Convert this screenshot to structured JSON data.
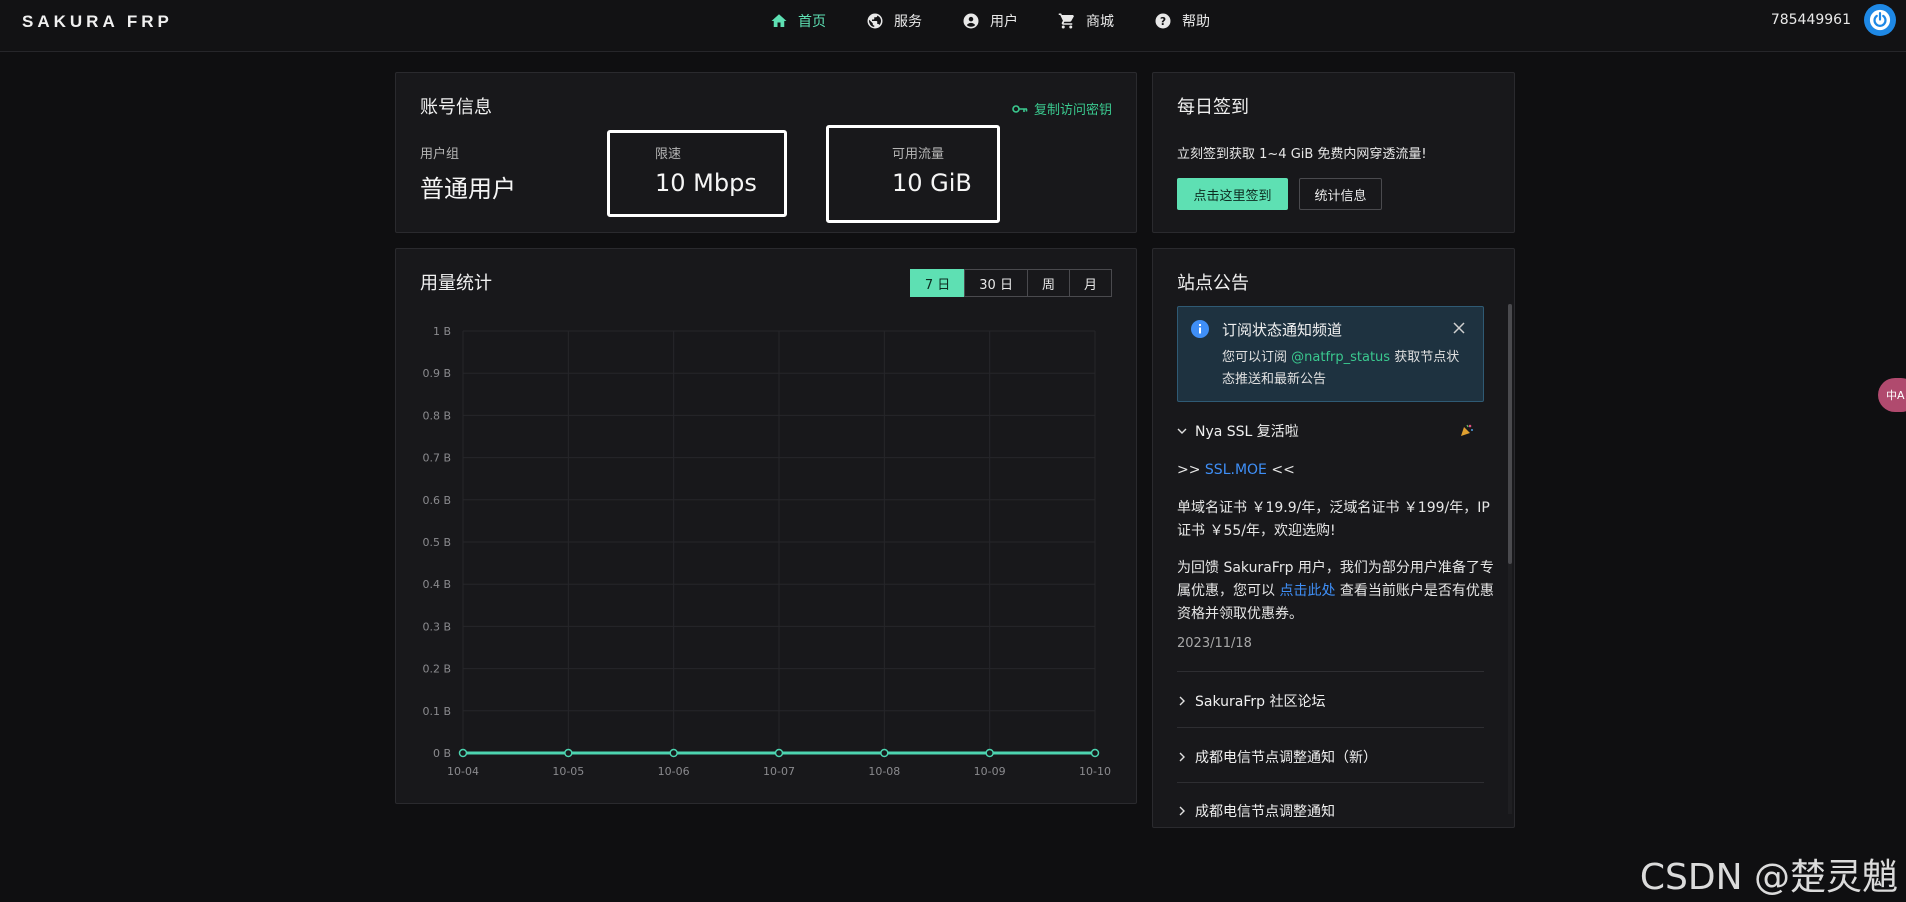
{
  "header": {
    "logo": "SAKURA FRP",
    "nav": [
      {
        "label": "首页",
        "icon": "home-icon",
        "active": true
      },
      {
        "label": "服务",
        "icon": "globe-icon",
        "active": false
      },
      {
        "label": "用户",
        "icon": "user-icon",
        "active": false
      },
      {
        "label": "商城",
        "icon": "cart-icon",
        "active": false
      },
      {
        "label": "帮助",
        "icon": "help-icon",
        "active": false
      }
    ],
    "user_id": "785449961"
  },
  "account": {
    "title": "账号信息",
    "copy_key": "复制访问密钥",
    "group_label": "用户组",
    "group_value": "普通用户",
    "speed_label": "限速",
    "speed_value": "10 Mbps",
    "traffic_label": "可用流量",
    "traffic_value": "10 GiB"
  },
  "checkin": {
    "title": "每日签到",
    "text": "立刻签到获取 1~4 GiB 免费内网穿透流量!",
    "primary_btn": "点击这里签到",
    "stats_btn": "统计信息"
  },
  "usage": {
    "title": "用量统计",
    "tabs": [
      "7 日",
      "30 日",
      "周",
      "月"
    ],
    "active_tab": 0
  },
  "chart_data": {
    "type": "line",
    "categories": [
      "10-04",
      "10-05",
      "10-06",
      "10-07",
      "10-08",
      "10-09",
      "10-10"
    ],
    "values": [
      0,
      0,
      0,
      0,
      0,
      0,
      0
    ],
    "y_ticks": [
      "0 B",
      "0.1 B",
      "0.2 B",
      "0.3 B",
      "0.4 B",
      "0.5 B",
      "0.6 B",
      "0.7 B",
      "0.8 B",
      "0.9 B",
      "1 B"
    ],
    "ylim": [
      0,
      1
    ],
    "grid": true,
    "color": "#4dd4b0"
  },
  "notice": {
    "title": "站点公告",
    "alert": {
      "title": "订阅状态通知频道",
      "body_before": "您可以订阅 ",
      "body_link": "@natfrp_status",
      "body_after": " 获取节点状态推送和最新公告"
    },
    "items": [
      {
        "title": "Nya SSL 复活啦",
        "expanded": true
      },
      {
        "title": "SakuraFrp 社区论坛",
        "expanded": false
      },
      {
        "title": "成都电信节点调整通知（新）",
        "expanded": false
      },
      {
        "title": "成都电信节点调整通知",
        "expanded": false
      }
    ],
    "ssl_prefix": ">> ",
    "ssl_link": "SSL.MOE",
    "ssl_suffix": " <<",
    "price_text": "单域名证书 ￥19.9/年，泛域名证书 ￥199/年，IP 证书 ￥55/年，欢迎选购!",
    "promo_before": "为回馈 SakuraFrp 用户，我们为部分用户准备了专属优惠，您可以 ",
    "promo_link": "点击此处",
    "promo_after": " 查看当前账户是否有优惠资格并领取优惠券。",
    "date": "2023/11/18"
  },
  "side_float": "中A",
  "watermark": "CSDN @楚灵魈"
}
